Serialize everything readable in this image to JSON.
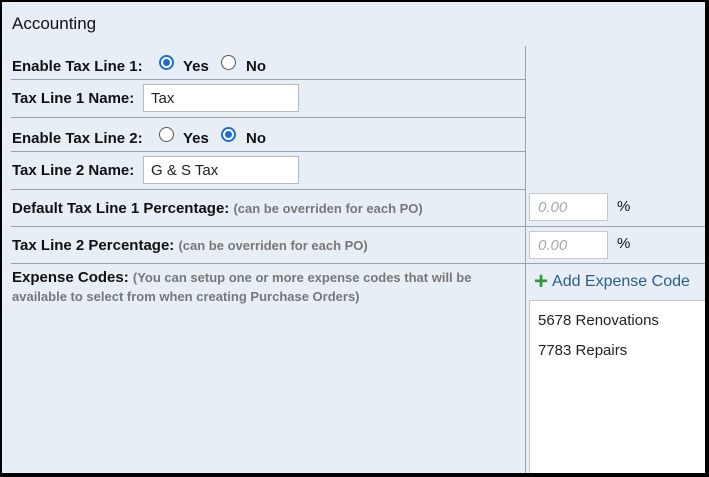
{
  "section_title": "Accounting",
  "tax_line1": {
    "label": "Enable Tax Line 1:",
    "yes": "Yes",
    "no": "No",
    "selected": "Yes",
    "name_label": "Tax Line 1 Name:",
    "name_value": "Tax"
  },
  "tax_line2": {
    "label": "Enable Tax Line 2:",
    "yes": "Yes",
    "no": "No",
    "selected": "No",
    "name_label": "Tax Line 2 Name:",
    "name_value": "G & S Tax"
  },
  "default_pct1": {
    "label": "Default Tax Line 1 Percentage:",
    "hint": "(can be overriden for each PO)",
    "placeholder": "0.00",
    "suffix": "%"
  },
  "pct2": {
    "label": "Tax Line 2 Percentage:",
    "hint": "(can be overriden for each PO)",
    "placeholder": "0.00",
    "suffix": "%"
  },
  "expense": {
    "label": "Expense Codes:",
    "hint": "(You can setup one or more expense codes that will be available to select from when creating Purchase Orders)",
    "add_label": "Add Expense Code",
    "add_icon": "plus-icon",
    "codes": [
      "5678 Renovations",
      "7783 Repairs"
    ]
  },
  "colors": {
    "background": "#e7eef6",
    "radio_selected": "#1a6fd6",
    "add_link": "#2b5f86",
    "plus_icon": "#2e9a3c"
  }
}
